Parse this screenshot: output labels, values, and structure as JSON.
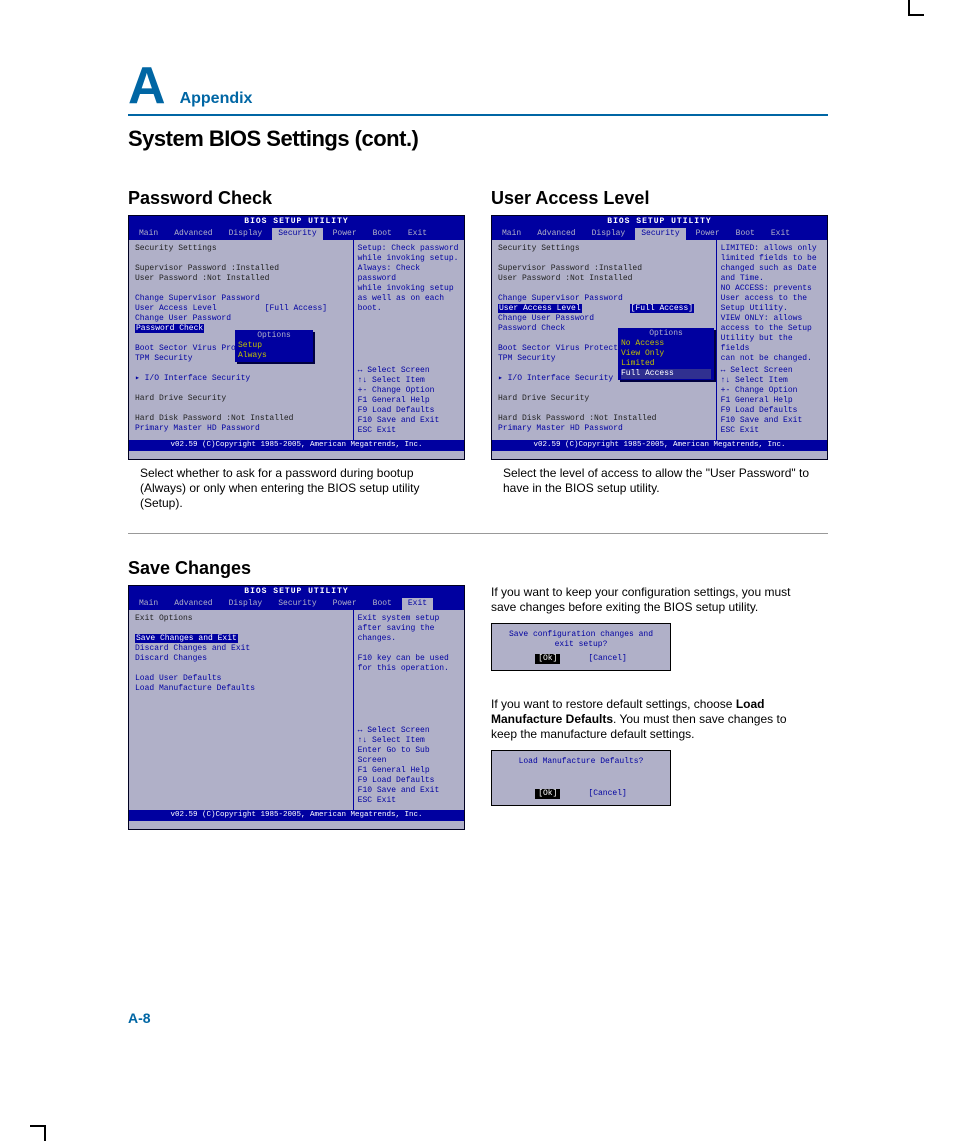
{
  "header": {
    "letter": "A",
    "appendix": "Appendix",
    "title": "System BIOS Settings (cont.)"
  },
  "pw": {
    "title": "Password Check",
    "caption": "Select whether to ask for a password during bootup (Always) or only when entering the BIOS setup utility (Setup).",
    "bios_title": "BIOS SETUP UTILITY",
    "tabs": [
      "Main",
      "Advanced",
      "Display",
      "Security",
      "Power",
      "Boot",
      "Exit"
    ],
    "tab_selected": "Security",
    "section": "Security Settings",
    "l1": "Supervisor Password :Installed",
    "l2": "User Password       :Not Installed",
    "l3": "Change Supervisor Password",
    "l4": "User Access Level",
    "l4v": "[Full Access]",
    "l5": "Change User Password",
    "l6": "Password Check",
    "popup_h": "Options",
    "popup_o1": "Setup",
    "popup_o2": "Always",
    "l7": "Boot Sector Virus Protectio",
    "l8": "TPM Security",
    "l9": "▸ I/O Interface Security",
    "l10": "Hard Drive Security",
    "l11": "Hard Disk Password  :Not Installed",
    "l12": "Primary Master HD Password",
    "help": "Setup: Check password\nwhile invoking setup.\nAlways: Check password\nwhile invoking setup\nas well as on each\nboot.",
    "keys": "↔    Select Screen\n↑↓   Select Item\n+-   Change Option\nF1   General Help\nF9   Load Defaults\nF10  Save and Exit\nESC  Exit",
    "footer": "v02.59 (C)Copyright 1985-2005, American Megatrends, Inc."
  },
  "ua": {
    "title": "User Access Level",
    "caption": "Select the level of access to allow the \"User Password\" to have in the BIOS setup utility.",
    "section": "Security Settings",
    "l1": "Supervisor Password :Installed",
    "l2": "User Password       :Not Installed",
    "l3": "Change Supervisor Password",
    "l4": "User Access Level",
    "l4v": "[Full Access]",
    "l5": "Change User Password",
    "l6": "Password Check",
    "l7": "Boot Sector Virus Protectio",
    "l8": "TPM Security",
    "l9": "▸ I/O Interface Security",
    "l10": "Hard Drive Security",
    "l11": "Hard Disk Password  :Not Installed",
    "l12": "Primary Master HD Password",
    "popup_h": "Options",
    "popup_o1": "No Access",
    "popup_o2": "View Only",
    "popup_o3": "Limited",
    "popup_o4": "Full Access",
    "help": "LIMITED: allows only\nlimited fields to be\nchanged such as Date\nand Time.\nNO ACCESS: prevents\nUser access to the\nSetup Utility.\nVIEW ONLY: allows\naccess to the Setup\nUtility but the fields\ncan not be changed.",
    "keys": "↔    Select Screen\n↑↓   Select Item\n+-   Change Option\nF1   General Help\nF9   Load Defaults\nF10  Save and Exit\nESC  Exit"
  },
  "sc": {
    "title": "Save Changes",
    "section": "Exit Options",
    "tab_selected": "Exit",
    "l1": "Save Changes and Exit",
    "l2": "Discard Changes and Exit",
    "l3": "Discard Changes",
    "l4": "Load User Defaults",
    "l5": "Load Manufacture Defaults",
    "help": "Exit system setup\nafter saving the\nchanges.\n\nF10 key can be used\nfor this operation.",
    "keys": "↔    Select Screen\n↑↓   Select Item\nEnter Go to Sub Screen\nF1   General Help\nF9   Load Defaults\nF10  Save and Exit\nESC  Exit",
    "p1": "If you want to keep your configuration settings, you must save changes before exiting the BIOS setup utility.",
    "d1": "Save configuration changes and exit setup?",
    "ok": "[Ok]",
    "cancel": "[Cancel]",
    "p2a": "If you want to restore default settings, choose ",
    "p2b": "Load Manufacture Defaults",
    "p2c": ". You must then save changes to keep the manufacture default settings.",
    "d2": "Load Manufacture Defaults?"
  },
  "page_num": "A-8"
}
